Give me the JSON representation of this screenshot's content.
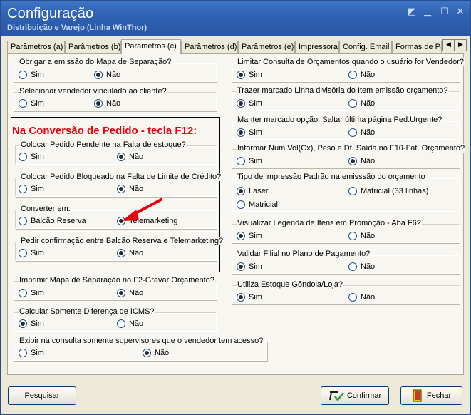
{
  "window": {
    "title": "Configuração",
    "subtitle": "Distribuição e Varejo (Linha WinThor)"
  },
  "tabs": [
    "Parâmetros (a)",
    "Parâmetros (b)",
    "Parâmetros (c)",
    "Parâmetros (d)",
    "Parâmetros (e)",
    "Impressora",
    "Config. Email",
    "Formas de Pa"
  ],
  "active_tab": "Parâmetros (c)",
  "left": {
    "g1": {
      "label": "Obrigar a emissão do Mapa de Separação?",
      "opt1": "Sim",
      "opt2": "Não",
      "selected": "Não"
    },
    "g2": {
      "label": "Selecionar vendedor vinculado ao cliente?",
      "opt1": "Sim",
      "opt2": "Não",
      "selected": "Não"
    },
    "section_title": "Na Conversão de Pedido - tecla F12:",
    "g3": {
      "label": "Colocar Pedido Pendente na Falta de estoque?",
      "opt1": "Sim",
      "opt2": "Não",
      "selected": "Não"
    },
    "g4": {
      "label": "Colocar Pedido Bloqueado na Falta de Limite de Crédito?",
      "opt1": "Sim",
      "opt2": "Não",
      "selected": "Não"
    },
    "g5": {
      "label": "Converter em:",
      "opt1": "Balcão Reserva",
      "opt2": "Telemarketing",
      "selected": "Telemarketing"
    },
    "g6": {
      "label": "Pedir confirmação entre Balcão Reserva e Telemarketing?",
      "opt1": "Sim",
      "opt2": "Não",
      "selected": "Não"
    },
    "g7": {
      "label": "Imprimir Mapa de Separação no F2-Gravar Orçamento?",
      "opt1": "Sim",
      "opt2": "Não",
      "selected": "Não"
    },
    "g8": {
      "label": "Calcular Somente Diferença de ICMS?",
      "opt1": "Sim",
      "opt2": "Não",
      "selected": "Sim"
    },
    "g9": {
      "label": "Exibir na consulta somente supervisores que o vendedor tem acesso?",
      "opt1": "Sim",
      "opt2": "Não",
      "selected": "Não"
    }
  },
  "right": {
    "r1": {
      "label": "Limitar Consulta de Orçamentos quando o usuário for Vendedor?",
      "opt1": "Sim",
      "opt2": "Não",
      "selected": "Sim"
    },
    "r2": {
      "label": "Trazer marcado Linha divisória do Item emissão orçamento?",
      "opt1": "Sim",
      "opt2": "Não",
      "selected": "Sim"
    },
    "r3": {
      "label": "Manter marcado opção: Saltar última página Ped.Urgente?",
      "opt1": "Sim",
      "opt2": "Não",
      "selected": "Sim"
    },
    "r4": {
      "label": "Informar Núm.Vol(Cx), Peso e Dt. Saída no F10-Fat. Orçamento?",
      "opt1": "Sim",
      "opt2": "Não",
      "selected": "Não"
    },
    "r5": {
      "label": "Tipo de impressão Padrão na emisssão do orçamento",
      "opt1": "Laser",
      "opt2": "Matricial (33 linhas)",
      "opt3": "Matricial",
      "selected": "Laser"
    },
    "r6": {
      "label": "Visualizar Legenda de Itens em Promoção - Aba F6?",
      "opt1": "Sim",
      "opt2": "Não",
      "selected": "Sim"
    },
    "r7": {
      "label": "Validar Filial no Plano de Pagamento?",
      "opt1": "Sim",
      "opt2": "Não",
      "selected": "Sim"
    },
    "r8": {
      "label": "Utiliza Estoque Gôndola/Loja?",
      "opt1": "Sim",
      "opt2": "Não",
      "selected": "Sim"
    }
  },
  "buttons": {
    "search": "Pesquisar",
    "confirm": "Confirmar",
    "close": "Fechar"
  },
  "colors": {
    "title_bar": "#2f62b3",
    "highlight_title": "#e8000b",
    "arrow": "#e8000b"
  }
}
